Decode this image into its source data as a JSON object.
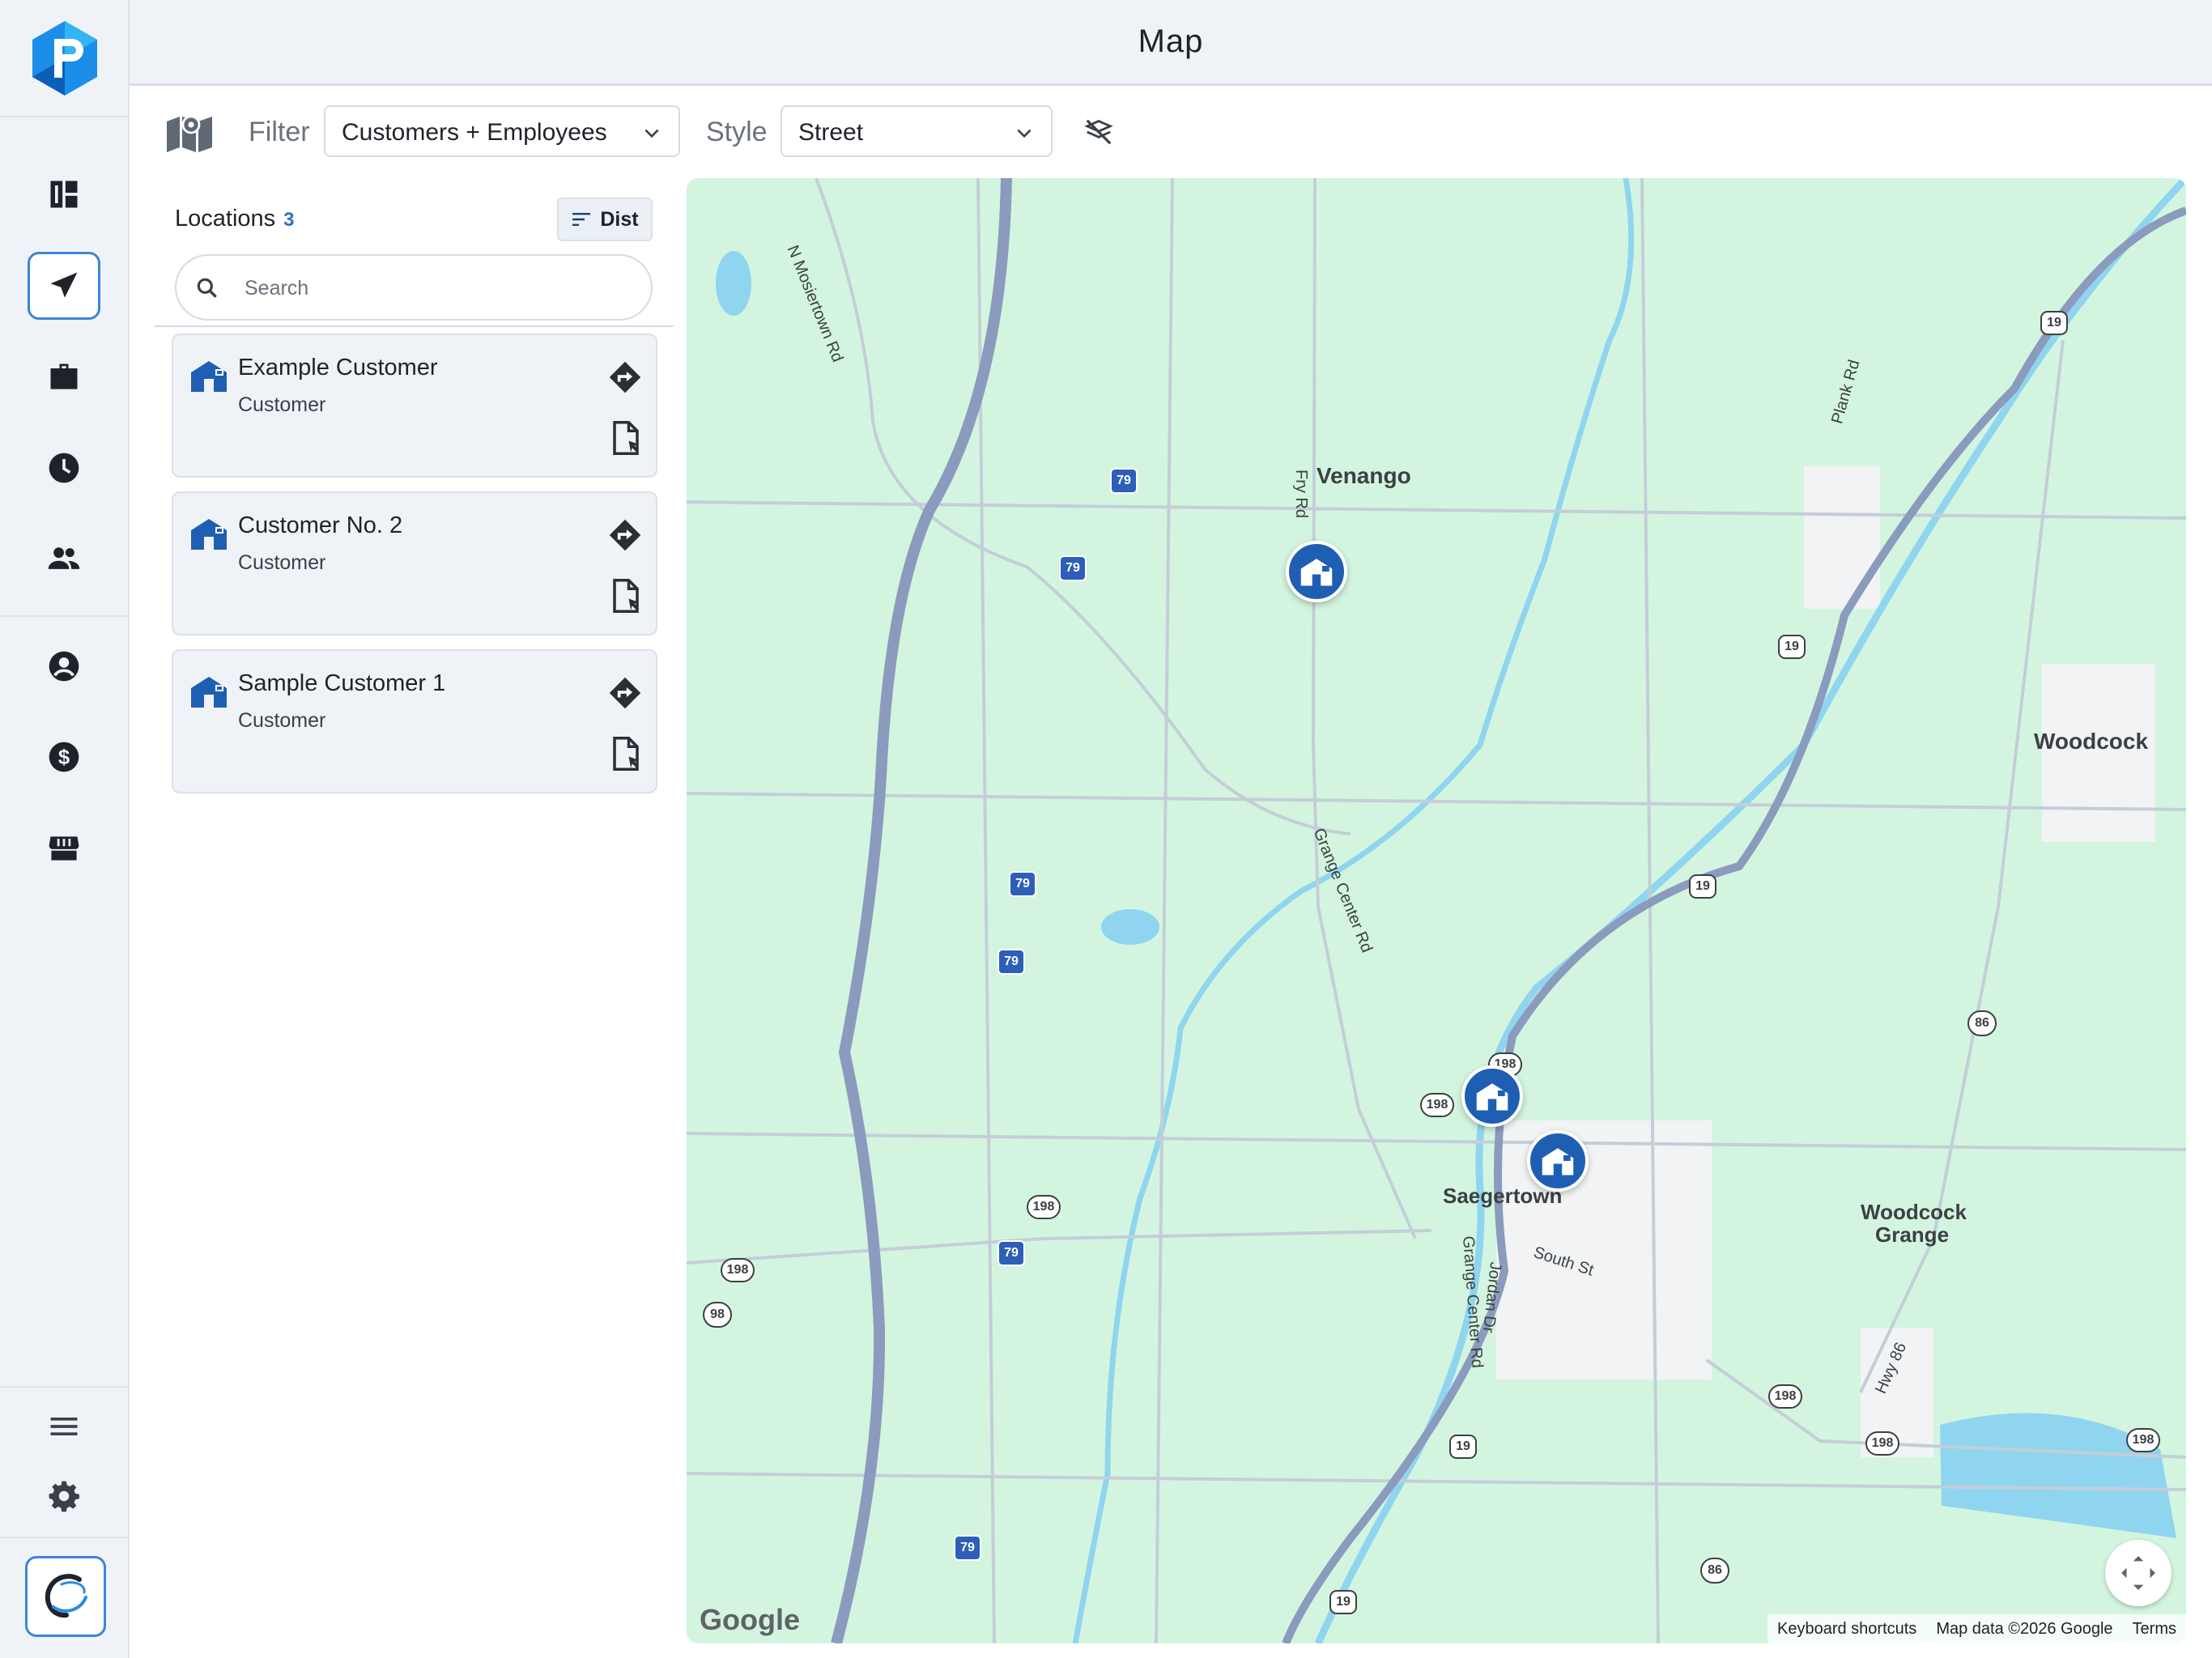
{
  "header": {
    "title": "Map"
  },
  "toolbar": {
    "filter_label": "Filter",
    "filter_value": "Customers + Employees",
    "style_label": "Style",
    "style_value": "Street"
  },
  "sidebar_nav": {
    "items": [
      "dashboard-icon",
      "navigation-icon",
      "briefcase-icon",
      "clock-icon",
      "people-icon",
      "account-icon",
      "dollar-icon",
      "store-icon"
    ],
    "bottom_items": [
      "menu-icon",
      "gear-icon"
    ],
    "active": "navigation-icon",
    "accent": "#3a86d6"
  },
  "locations": {
    "label": "Locations",
    "count": "3",
    "sort_label": "Dist",
    "search_placeholder": "Search",
    "items": [
      {
        "name": "Example Customer",
        "type": "Customer"
      },
      {
        "name": "Customer No. 2",
        "type": "Customer"
      },
      {
        "name": "Sample Customer 1",
        "type": "Customer"
      }
    ]
  },
  "map": {
    "places": [
      "Venango",
      "Woodcock",
      "Saegertown",
      "Woodcock",
      "Grange"
    ],
    "roads": [
      "N Mosiertown Rd",
      "Fry Rd",
      "Grange Center Rd",
      "Plank Rd",
      "South St",
      "Jordan Dr",
      "Grange Center Rd",
      "Hwy 86"
    ],
    "shields": [
      "79",
      "79",
      "79",
      "79",
      "79",
      "79",
      "19",
      "19",
      "19",
      "19",
      "19",
      "198",
      "198",
      "198",
      "198",
      "198",
      "198",
      "198",
      "98",
      "86",
      "86"
    ],
    "attribution": {
      "logo": "Google",
      "shortcuts": "Keyboard shortcuts",
      "data": "Map data ©2026 Google",
      "terms": "Terms"
    },
    "colors": {
      "land": "#d3f5df",
      "water": "#8fd5ef",
      "highway": "#8a9bbd",
      "town": "#f1f3f4",
      "pin": "#1f5fb3"
    }
  }
}
